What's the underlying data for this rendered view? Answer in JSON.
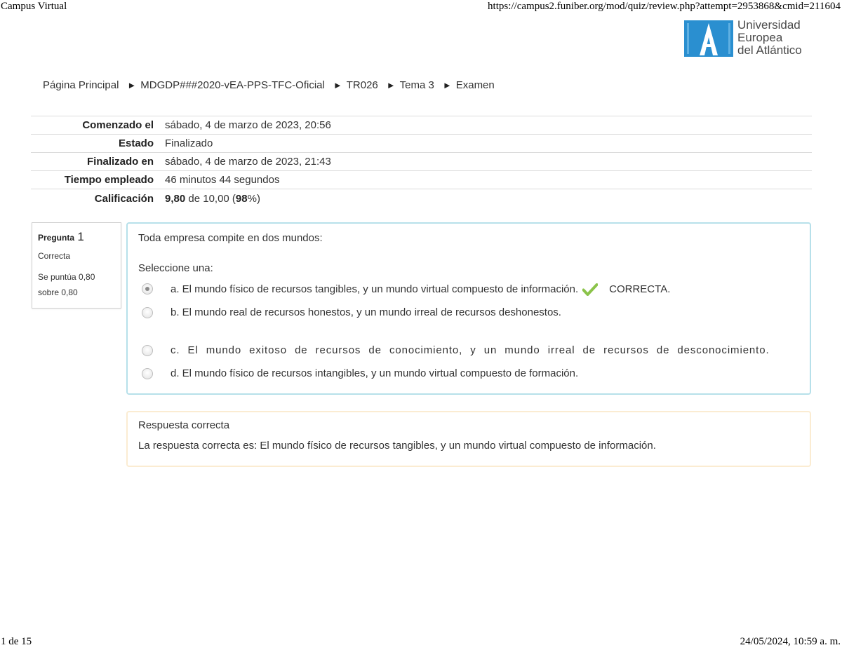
{
  "print_header": {
    "title": "Campus Virtual",
    "url": "https://campus2.funiber.org/mod/quiz/review.php?attempt=2953868&cmid=211604"
  },
  "logo": {
    "line1": "Universidad",
    "line2": "Europea",
    "line3": "del Atlántico",
    "color": "#2a8fd0"
  },
  "breadcrumb": {
    "items": [
      "Página Principal",
      "MDGDP###2020-vEA-PPS-TFC-Oficial",
      "TR026",
      "Tema 3",
      "Examen"
    ],
    "separator": "►"
  },
  "summary": {
    "rows": [
      {
        "label": "Comenzado el",
        "value": "sábado, 4 de marzo de 2023, 20:56"
      },
      {
        "label": "Estado",
        "value": "Finalizado"
      },
      {
        "label": "Finalizado en",
        "value": "sábado, 4 de marzo de 2023, 21:43"
      },
      {
        "label": "Tiempo empleado",
        "value": "46 minutos 44 segundos"
      }
    ],
    "grade": {
      "label": "Calificación",
      "score": "9,80",
      "of": " de 10,00 (",
      "percent": "98",
      "close": "%)"
    }
  },
  "question": {
    "label": "Pregunta",
    "number": "1",
    "state": "Correcta",
    "grade_line1": "Se puntúa 0,80",
    "grade_line2": "sobre 0,80",
    "text": "Toda empresa compite en dos mundos:",
    "prompt": "Seleccione una:",
    "answers": [
      {
        "text": "a. El mundo físico de recursos tangibles, y un mundo virtual compuesto de información.",
        "selected": true,
        "feedback": "CORRECTA."
      },
      {
        "text": "b. El mundo real de recursos honestos, y un mundo irreal de recursos deshonestos.",
        "selected": false
      },
      {
        "text": "c. El mundo exitoso de recursos de conocimiento, y un mundo irreal de recursos de desconocimiento.",
        "selected": false
      },
      {
        "text": "d. El mundo físico de recursos intangibles, y un mundo virtual compuesto de formación.",
        "selected": false
      }
    ],
    "check_color": "#8bc34a",
    "border_color": "#b7e0ea"
  },
  "feedback": {
    "title": "Respuesta correcta",
    "text": "La respuesta correcta es: El mundo físico de recursos tangibles, y un mundo virtual compuesto de información.",
    "border_color": "#fbecd2"
  },
  "print_footer": {
    "page": "1 de 15",
    "datetime": "24/05/2024, 10:59 a. m."
  }
}
